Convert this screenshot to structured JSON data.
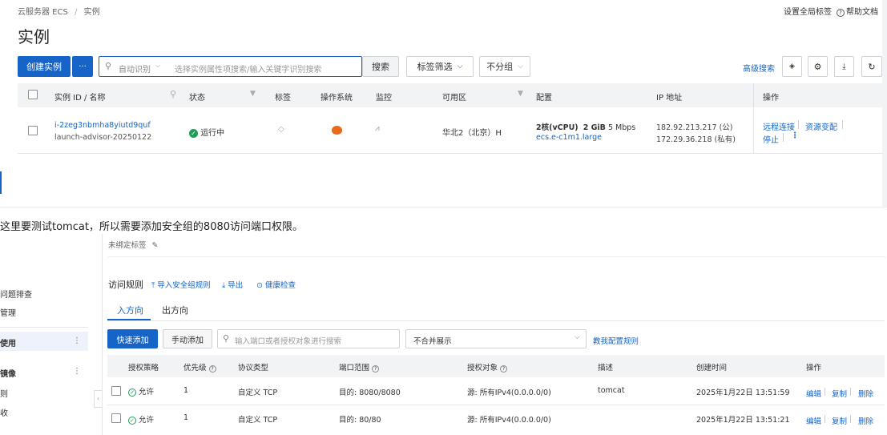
{
  "breadcrumb": {
    "root": "云服务器 ECS",
    "sep": "/",
    "current": "实例"
  },
  "top_links": {
    "tags": "设置全局标签",
    "help": "帮助文档"
  },
  "page_title": "实例",
  "toolbar": {
    "create": "创建实例",
    "more": "···",
    "filter_type": "自动识别",
    "search_placeholder": "选择实例属性项搜索/输入关键字识别搜索",
    "search": "搜索",
    "tag_filter": "标签筛选",
    "group": "不分组",
    "advanced": "高级搜索"
  },
  "instance_table": {
    "headers": {
      "id": "实例 ID / 名称",
      "status": "状态",
      "tag": "标签",
      "os": "操作系统",
      "monitor": "监控",
      "zone": "可用区",
      "config": "配置",
      "ip": "IP 地址",
      "ops": "操作"
    },
    "row": {
      "id": "i-2zeg3nbmha8yiutd9quf",
      "name": "launch-advisor-20250122",
      "status": "运行中",
      "zone": "华北2（北京）H",
      "config_cpu": "2核(vCPU)",
      "config_mem": "2 GiB",
      "config_bw": "5 Mbps",
      "config_type": "ecs.e-c1m1.large",
      "ip_public": "182.92.213.217 (公)",
      "ip_private": "172.29.36.218 (私有)",
      "op_remote": "远程连接",
      "op_change": "资源变配",
      "op_stop": "停止"
    }
  },
  "note": "这里要测试tomcat，所以需要添加安全组的8080访问端口权限。",
  "left_nav": {
    "item1": "问题排查",
    "item2": "管理",
    "item3": "使用",
    "item4": "镜像",
    "item5": "则",
    "item6": "收"
  },
  "security": {
    "tag_label": "未绑定标签",
    "section": "访问规则",
    "import": "导入安全组规则",
    "export": "导出",
    "health": "健康检查",
    "tabs": [
      "入方向",
      "出方向"
    ],
    "quick_add": "快速添加",
    "manual_add": "手动添加",
    "search_placeholder": "输入端口或者授权对象进行搜索",
    "merge": "不合并展示",
    "teach": "教我配置规则",
    "headers": [
      "授权策略",
      "优先级",
      "协议类型",
      "端口范围",
      "授权对象",
      "描述",
      "创建时间",
      "操作"
    ],
    "rows": [
      {
        "policy": "允许",
        "priority": "1",
        "protocol": "自定义 TCP",
        "port": "目的: 8080/8080",
        "source": "源: 所有IPv4(0.0.0.0/0)",
        "desc": "tomcat",
        "time": "2025年1月22日 13:51:59",
        "ops": [
          "编辑",
          "复制",
          "删除"
        ]
      },
      {
        "policy": "允许",
        "priority": "1",
        "protocol": "自定义 TCP",
        "port": "目的: 80/80",
        "source": "源: 所有IPv4(0.0.0.0/0)",
        "desc": "",
        "time": "2025年1月22日 13:51:21",
        "ops": [
          "编辑",
          "复制",
          "删除"
        ]
      }
    ]
  }
}
